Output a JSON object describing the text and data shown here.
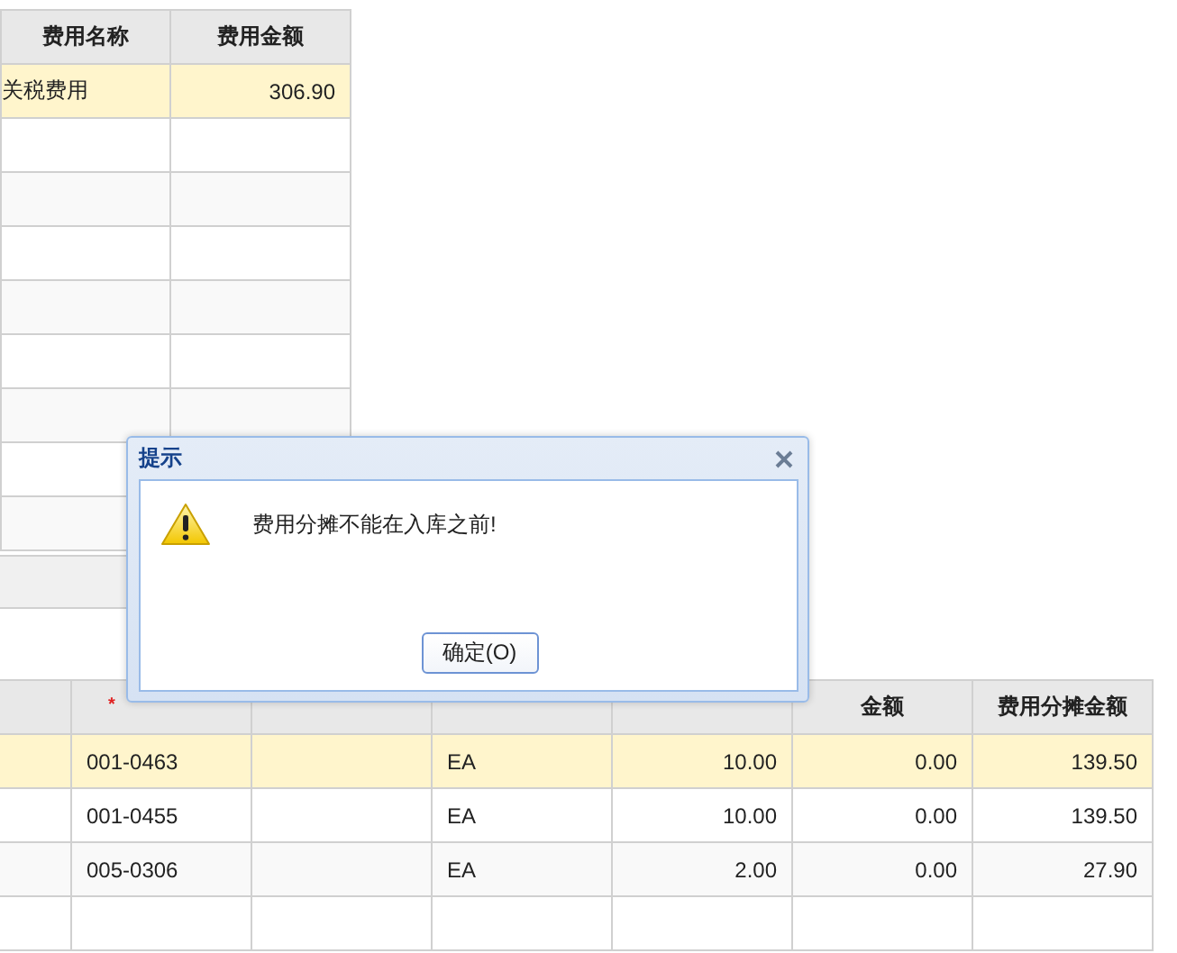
{
  "fee_table": {
    "columns": [
      {
        "label": "费用名称",
        "kind": "text"
      },
      {
        "label": "费用金额",
        "kind": "number"
      }
    ],
    "rows": [
      {
        "cells": [
          "关税费用",
          "306.90"
        ],
        "selected": true
      }
    ]
  },
  "detail_table": {
    "columns": [
      {
        "kind": "text",
        "required_mark": "*"
      },
      {
        "kind": "text"
      },
      {
        "kind": "text"
      },
      {
        "kind": "number"
      },
      {
        "label": "金额",
        "kind": "number"
      },
      {
        "label": "费用分摊金额",
        "kind": "number"
      }
    ],
    "rows": [
      {
        "cells": [
          "001-0463",
          "",
          "EA",
          "10.00",
          "0.00",
          "139.50"
        ],
        "selected": true
      },
      {
        "cells": [
          "001-0455",
          "",
          "EA",
          "10.00",
          "0.00",
          "139.50"
        ],
        "selected": false
      },
      {
        "cells": [
          "005-0306",
          "",
          "EA",
          "2.00",
          "0.00",
          "27.90"
        ],
        "selected": false
      }
    ]
  },
  "dialog": {
    "title": "提示",
    "message": "费用分摊不能在入库之前!",
    "button": "确定(O)"
  }
}
